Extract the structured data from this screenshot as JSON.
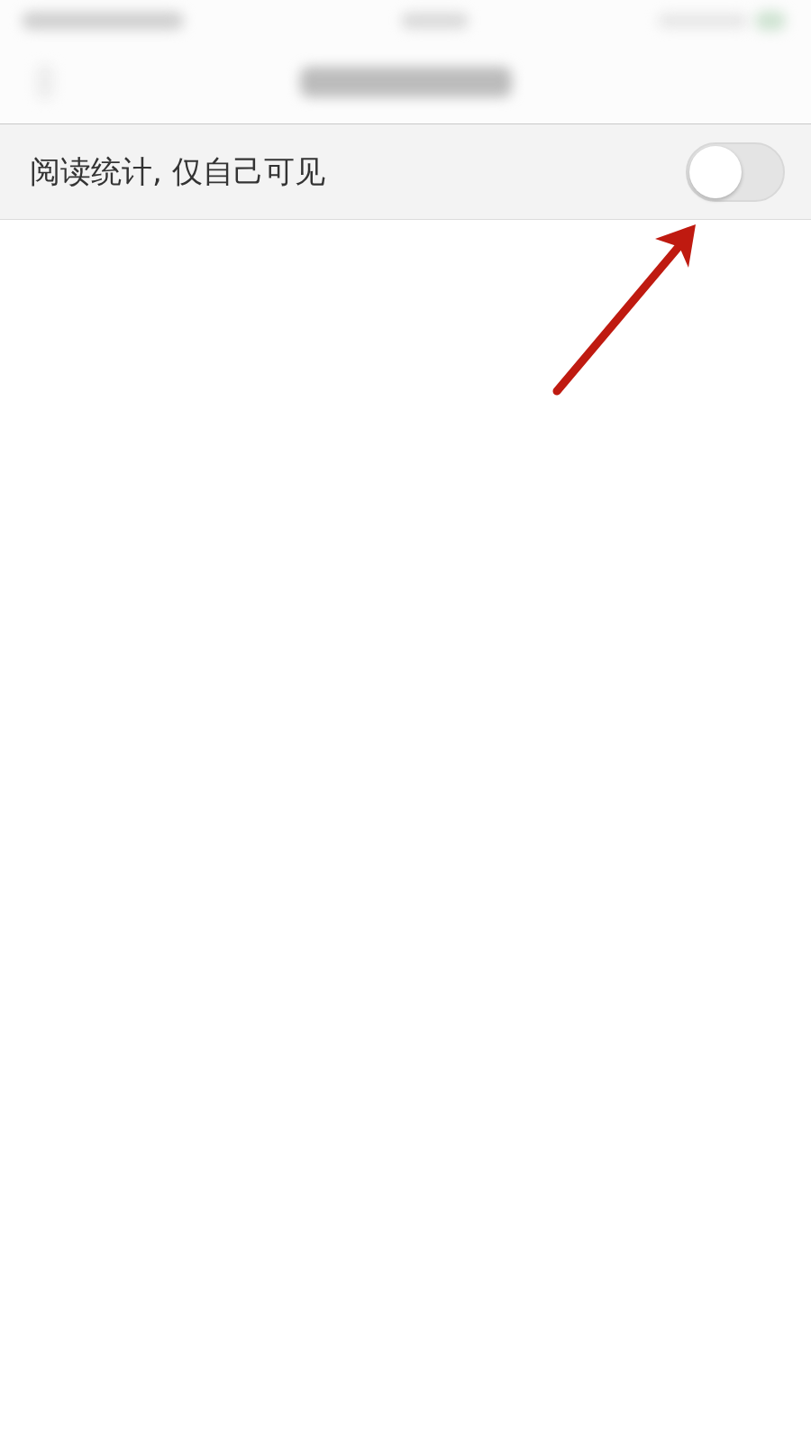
{
  "settings_rows": [
    {
      "label": "阅读统计, 仅自己可见",
      "on": false
    }
  ]
}
